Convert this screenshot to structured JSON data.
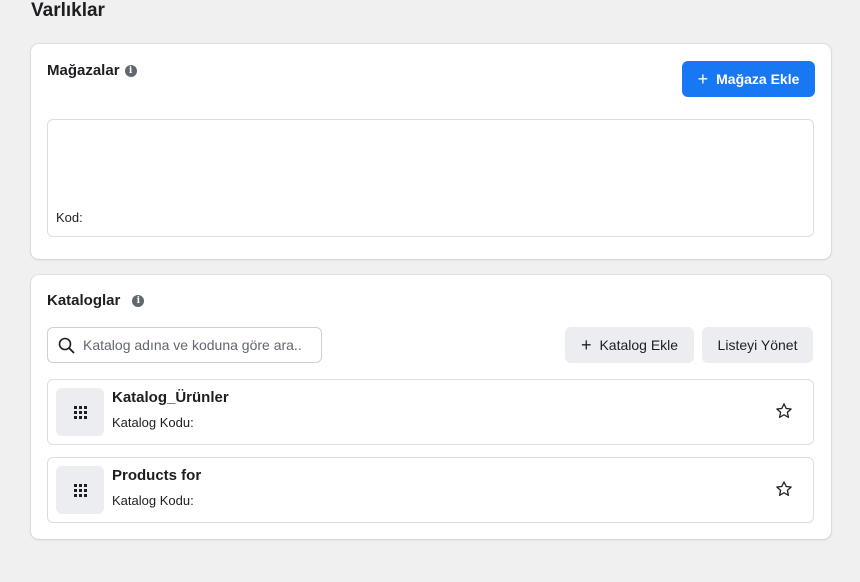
{
  "page": {
    "title": "Varlıklar"
  },
  "stores": {
    "title": "Mağazalar",
    "add_button": "Mağaza Ekle",
    "code_label": "Kod:"
  },
  "catalogs": {
    "title": "Kataloglar",
    "search_placeholder": "Katalog adına ve koduna göre ara...",
    "add_button": "Katalog Ekle",
    "manage_button": "Listeyi Yönet",
    "items": [
      {
        "name": "Katalog_Ürünler",
        "code_label": "Katalog Kodu:"
      },
      {
        "name": "Products for",
        "code_label": "Katalog Kodu:"
      }
    ]
  },
  "colors": {
    "primary": "#1877f2",
    "background": "#f0f0f0",
    "secondary_button": "#ebedf0"
  },
  "icons": {
    "info": "info-icon",
    "plus": "plus-icon",
    "search": "search-icon",
    "catalog_thumb": "grid-icon",
    "favorite": "star-icon"
  }
}
